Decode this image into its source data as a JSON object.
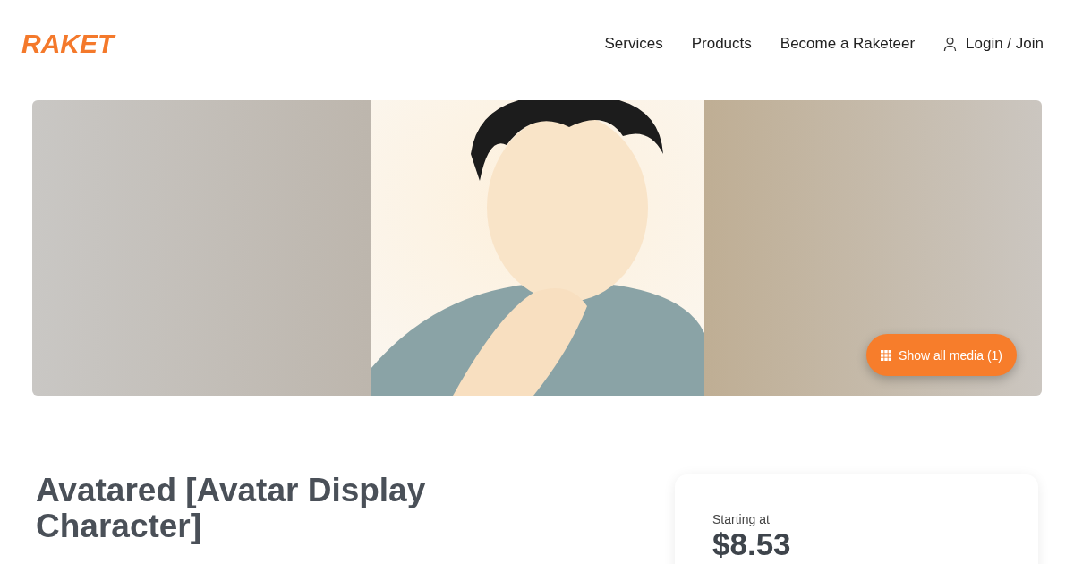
{
  "header": {
    "logo": "RAKET",
    "nav": [
      {
        "label": "Services",
        "kind": "link"
      },
      {
        "label": "Products",
        "kind": "link"
      },
      {
        "label": "Become a Raketeer",
        "kind": "link"
      },
      {
        "label": "Login / Join",
        "kind": "account"
      }
    ]
  },
  "hero": {
    "button": "Show all media (1)"
  },
  "title": "Avatared [Avatar Display Character]",
  "price_card": {
    "label": "Starting at",
    "price": "$8.53"
  }
}
